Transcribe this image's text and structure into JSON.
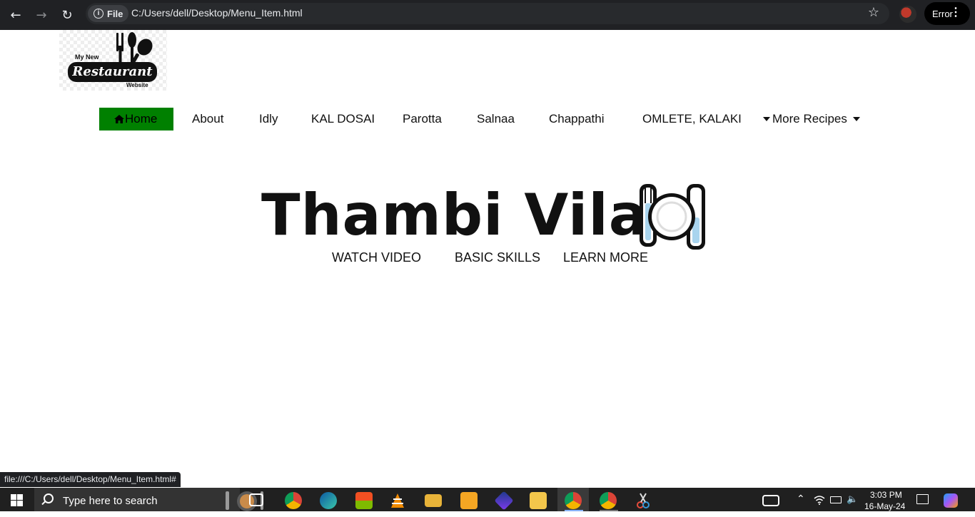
{
  "browser": {
    "file_chip_label": "File",
    "url": "C:/Users/dell/Desktop/Menu_Item.html",
    "error_label": "Error"
  },
  "logo": {
    "line_top": "My New",
    "line_main": "Restaurant",
    "line_bottom": "Website"
  },
  "menu": {
    "items": [
      {
        "label": "Home",
        "active": true
      },
      {
        "label": "About"
      },
      {
        "label": "Idly"
      },
      {
        "label": "KAL DOSAI"
      },
      {
        "label": "Parotta"
      },
      {
        "label": "Salnaa"
      },
      {
        "label": "Chappathi"
      },
      {
        "label": "OMLETE, KALAKI"
      },
      {
        "label": "More Recipes"
      }
    ]
  },
  "hero": {
    "title": "Thambi Vilas",
    "links": [
      "WATCH VIDEO",
      "BASIC SKILLS",
      "LEARN MORE"
    ]
  },
  "status_bar": {
    "link_preview": "file:///C:/Users/dell/Desktop/Menu_Item.html#"
  },
  "taskbar": {
    "search_placeholder": "Type here to search",
    "time": "3:03 PM",
    "date": "16-May-24"
  },
  "colors": {
    "active_menu_bg": "#008000",
    "chrome_bg": "#202124",
    "taskbar_bg": "#202020"
  }
}
